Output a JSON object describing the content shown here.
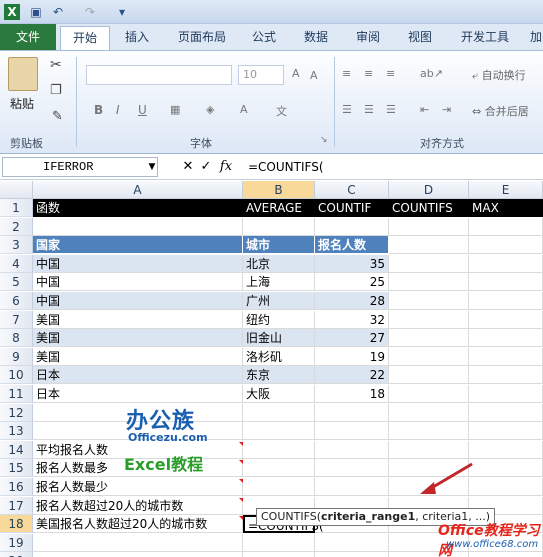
{
  "quick_access": {
    "icons": [
      "excel-logo-icon",
      "save-icon",
      "undo-icon",
      "redo-icon",
      "customize-qat-icon"
    ]
  },
  "tabs": [
    "文件",
    "开始",
    "插入",
    "页面布局",
    "公式",
    "数据",
    "审阅",
    "视图",
    "开发工具",
    "加"
  ],
  "ribbon": {
    "paste_label": "粘贴",
    "clipboard_label": "剪贴板",
    "font_label": "字体",
    "font_size": "10",
    "align_label": "对齐方式",
    "wrap_label": "自动换行",
    "merge_label": "合并后居"
  },
  "formula_bar": {
    "name_box": "IFERROR",
    "fx": "fx",
    "formula": "=COUNTIFS("
  },
  "columns": [
    "A",
    "B",
    "C",
    "D",
    "E"
  ],
  "rows": [
    "1",
    "2",
    "3",
    "4",
    "5",
    "6",
    "7",
    "8",
    "9",
    "10",
    "11",
    "12",
    "13",
    "14",
    "15",
    "16",
    "17",
    "18",
    "19",
    "20"
  ],
  "sheet": {
    "row1": [
      "函数",
      "AVERAGE",
      "COUNTIF",
      "COUNTIFS",
      "MAX"
    ],
    "table_header": [
      "国家",
      "城市",
      "报名人数"
    ],
    "table_rows": [
      [
        "中国",
        "北京",
        "35"
      ],
      [
        "中国",
        "上海",
        "25"
      ],
      [
        "中国",
        "广州",
        "28"
      ],
      [
        "美国",
        "纽约",
        "32"
      ],
      [
        "美国",
        "旧金山",
        "27"
      ],
      [
        "美国",
        "洛杉矶",
        "19"
      ],
      [
        "日本",
        "东京",
        "22"
      ],
      [
        "日本",
        "大阪",
        "18"
      ]
    ],
    "questions": [
      "平均报名人数",
      "报名人数最多",
      "报名人数最少",
      "报名人数超过20人的城市数",
      "美国报名人数超过20人的城市数"
    ],
    "editing_cell": "=COUNTIFS("
  },
  "tooltip": {
    "func": "COUNTIFS(",
    "arg_bold": "criteria_range1",
    ", criteria1, ...)": "",
    "rest": ", criteria1, ...)"
  },
  "overlays": {
    "logo_main": "办公族",
    "logo_url": "Officezu.com",
    "logo_tutorial": "Excel教程",
    "watermark": "Office教程学习网",
    "watermark_url": "www.office68.com"
  },
  "colors": {
    "file_tab": "#2a7a3e",
    "table_header": "#4f81bd",
    "band": "#dbe5f1",
    "arrow": "#c0282a"
  }
}
